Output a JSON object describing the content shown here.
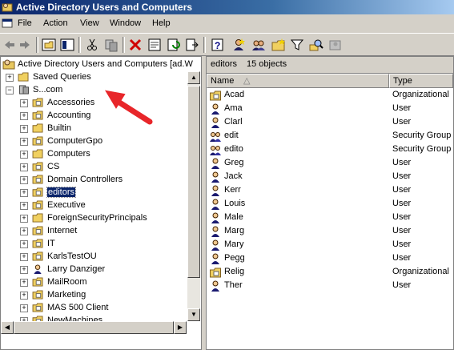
{
  "window": {
    "title": "Active Directory Users and Computers"
  },
  "menu": {
    "items": [
      "File",
      "Action",
      "View",
      "Window",
      "Help"
    ]
  },
  "tree": {
    "root_label": "Active Directory Users and Computers [ad.W",
    "items": [
      {
        "label": "Saved Queries",
        "level": 1
      },
      {
        "label": "S...com",
        "level": 1
      },
      {
        "label": "Accessories",
        "level": 2
      },
      {
        "label": "Accounting",
        "level": 2
      },
      {
        "label": "Builtin",
        "level": 2
      },
      {
        "label": "ComputerGpo",
        "level": 2
      },
      {
        "label": "Computers",
        "level": 2
      },
      {
        "label": "CS",
        "level": 2
      },
      {
        "label": "Domain Controllers",
        "level": 2
      },
      {
        "label": "editors",
        "level": 2
      },
      {
        "label": "Executive",
        "level": 2
      },
      {
        "label": "ForeignSecurityPrincipals",
        "level": 2
      },
      {
        "label": "Internet",
        "level": 2
      },
      {
        "label": "IT",
        "level": 2
      },
      {
        "label": "KarlsTestOU",
        "level": 2
      },
      {
        "label": "Larry Danziger",
        "level": 2
      },
      {
        "label": "MailRoom",
        "level": 2
      },
      {
        "label": "Marketing",
        "level": 2
      },
      {
        "label": "MAS 500 Client",
        "level": 2
      },
      {
        "label": "NewMachines",
        "level": 2
      }
    ]
  },
  "details": {
    "container": "editors",
    "count": "15 objects",
    "columns": [
      "Name",
      "Type"
    ],
    "rows": [
      {
        "name": "Acad",
        "type": "Organizational"
      },
      {
        "name": "Ama",
        "type": "User"
      },
      {
        "name": "Clarl",
        "type": "User"
      },
      {
        "name": "edit",
        "type": "Security Group"
      },
      {
        "name": "edito",
        "type": "Security Group"
      },
      {
        "name": "Greg",
        "type": "User"
      },
      {
        "name": "Jack",
        "type": "User"
      },
      {
        "name": "Kerr",
        "type": "User"
      },
      {
        "name": "Louis",
        "type": "User"
      },
      {
        "name": "Male",
        "type": "User"
      },
      {
        "name": "Marg",
        "type": "User"
      },
      {
        "name": "Mary",
        "type": "User"
      },
      {
        "name": "Pegg",
        "type": "User"
      },
      {
        "name": "Relig",
        "type": "Organizational"
      },
      {
        "name": "Ther",
        "type": "User"
      }
    ]
  },
  "colors": {
    "title_start": "#0a246a",
    "selection": "#0a246a",
    "annotation_arrow": "#e8262a"
  }
}
